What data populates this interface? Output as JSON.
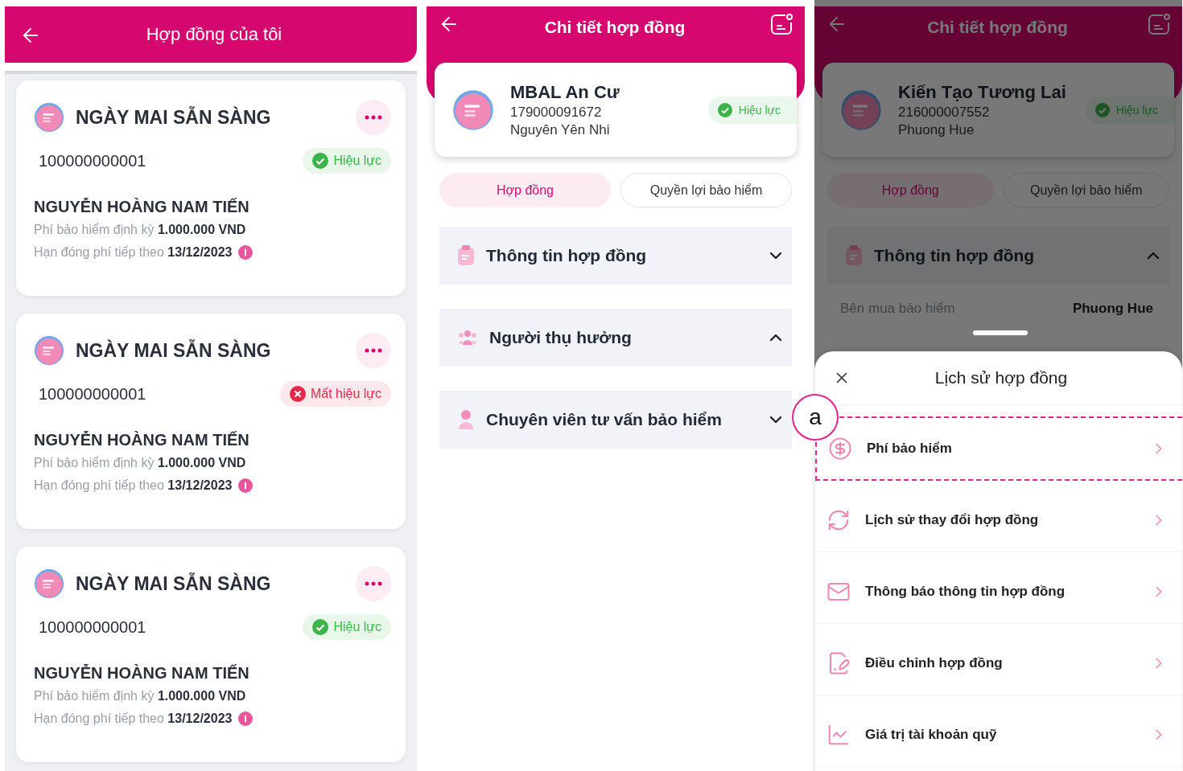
{
  "contract_list": {
    "header": {
      "title": "Hợp đồng của tôi"
    },
    "contracts": [
      {
        "product": "NGÀY MAI SẴN SÀNG",
        "number": "100000000001",
        "status": {
          "label": "Hiệu lực",
          "active": true
        },
        "holder": "NGUYỄN HOÀNG NAM TIẾN",
        "fee": "Phí bảo hiểm định kỳ **1.000.000 VND**",
        "due": "Hạn đóng phí tiếp theo **13/12/2023**"
      },
      {
        "product": "NGÀY MAI SẴN SÀNG",
        "number": "100000000001",
        "status": {
          "label": "Mất hiệu lực",
          "active": false
        },
        "holder": "NGUYỄN HOÀNG NAM TIẾN",
        "fee": "Phí bảo hiểm định kỳ **1.000.000 VND**",
        "due": "Hạn đóng phí tiếp theo **13/12/2023**"
      },
      {
        "product": "NGÀY MAI SẴN SÀNG",
        "number": "100000000001",
        "status": {
          "label": "Hiệu lực",
          "active": true
        },
        "holder": "NGUYỄN HOÀNG NAM TIẾN",
        "fee": "Phí bảo hiểm định kỳ **1.000.000 VND**",
        "due": "Hạn đóng phí tiếp theo **13/12/2023**"
      }
    ]
  },
  "contract_detail": {
    "header": {
      "title": "Chi tiết hợp đồng"
    },
    "summary": {
      "name": "MBAL An Cư",
      "number": "179000091672",
      "holder": "Nguyên Yên Nhi",
      "status": {
        "label": "Hiệu lực",
        "active": true
      }
    },
    "tabs": [
      {
        "label": "Hợp đồng",
        "selected": true
      },
      {
        "label": "Quyền lợi bảo hiểm",
        "selected": false
      }
    ],
    "sections": [
      {
        "kind": "document",
        "title": "Thông tin hợp đồng",
        "expanded": false
      },
      {
        "kind": "people",
        "title": "Người thụ hưởng",
        "expanded": true
      },
      {
        "kind": "person",
        "title": "Chuyên viên tư vấn bảo hiểm",
        "expanded": false
      }
    ]
  },
  "contract_history": {
    "dimmed": true,
    "header": {
      "title": "Chi tiết hợp đồng"
    },
    "summary": {
      "name": "Kiến Tạo Tương Lai",
      "number": "216000007552",
      "holder": "Phuong Hue",
      "status": {
        "label": "Hiệu lực",
        "active": true
      }
    },
    "tabs": [
      {
        "label": "Hợp đồng",
        "selected": true
      },
      {
        "label": "Quyền lợi bảo hiểm",
        "selected": false
      }
    ],
    "sections": [
      {
        "kind": "document",
        "title": "Thông tin hợp đồng",
        "expanded": true,
        "rows": [
          {
            "label": "Bên mua bảo hiểm",
            "value": "Phuong Hue"
          }
        ]
      }
    ],
    "sheet": {
      "title": "Lịch sử hợp đồng",
      "annotation": "a",
      "items": [
        {
          "kind": "fee",
          "label": "Phí bảo hiểm",
          "highlighted": true
        },
        {
          "kind": "change",
          "label": "Lịch sử thay đổi hợp đồng",
          "highlighted": false
        },
        {
          "kind": "notify",
          "label": "Thông báo thông tin hợp đồng",
          "highlighted": false
        },
        {
          "kind": "edit",
          "label": "Điều chỉnh hợp đồng",
          "highlighted": false
        },
        {
          "kind": "chart",
          "label": "Giá trị tài khoản quỹ",
          "highlighted": false
        }
      ]
    }
  }
}
